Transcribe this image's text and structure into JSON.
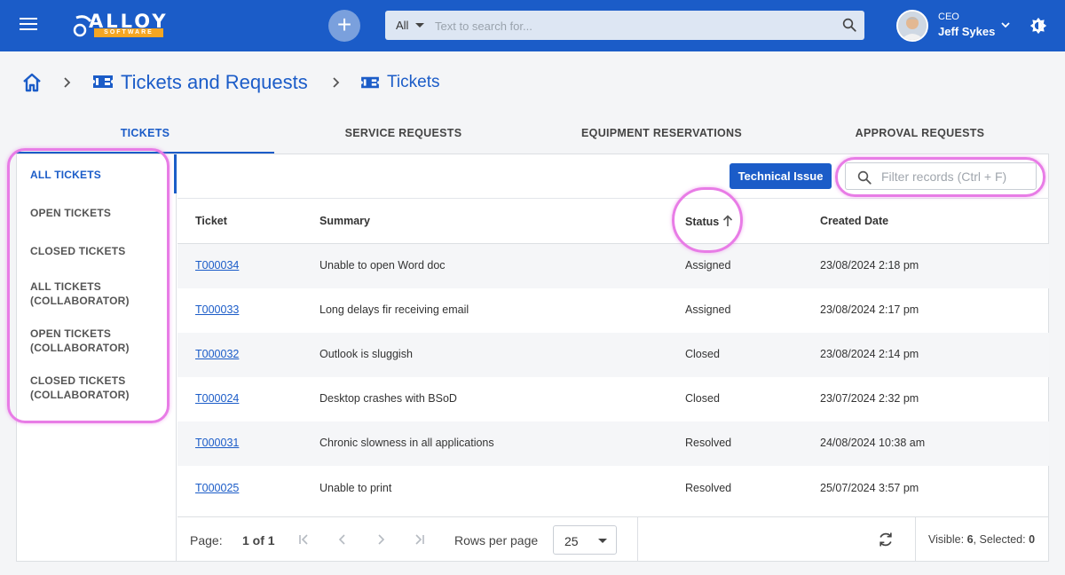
{
  "header": {
    "logo": {
      "word": "ALLOY",
      "sub": "SOFTWARE"
    },
    "add_button": "+",
    "search": {
      "scope": "All",
      "placeholder": "Text to search for..."
    },
    "user": {
      "role": "CEO",
      "name": "Jeff Sykes"
    }
  },
  "breadcrumb": {
    "section": "Tickets and Requests",
    "page": "Tickets"
  },
  "tabs": [
    {
      "label": "TICKETS",
      "active": true
    },
    {
      "label": "SERVICE REQUESTS",
      "active": false
    },
    {
      "label": "EQUIPMENT RESERVATIONS",
      "active": false
    },
    {
      "label": "APPROVAL REQUESTS",
      "active": false
    }
  ],
  "sidenav": {
    "items": [
      {
        "line1": "ALL TICKETS",
        "line2": ""
      },
      {
        "line1": "OPEN TICKETS",
        "line2": ""
      },
      {
        "line1": "CLOSED TICKETS",
        "line2": ""
      },
      {
        "line1": "ALL TICKETS",
        "line2": "(COLLABORATOR)"
      },
      {
        "line1": "OPEN TICKETS",
        "line2": "(COLLABORATOR)"
      },
      {
        "line1": "CLOSED TICKETS",
        "line2": "(COLLABORATOR)"
      }
    ]
  },
  "toolbar": {
    "tech_button": "Technical Issue",
    "filter_placeholder": "Filter records (Ctrl + F)"
  },
  "table": {
    "columns": [
      "Ticket",
      "Summary",
      "Status",
      "Created Date"
    ],
    "sort": {
      "column": "Status",
      "direction": "ascending"
    },
    "rows": [
      {
        "ticket": "T000034",
        "summary": "Unable to open Word doc",
        "status": "Assigned",
        "created": "23/08/2024 2:18 pm"
      },
      {
        "ticket": "T000033",
        "summary": "Long delays fir receiving email",
        "status": "Assigned",
        "created": "23/08/2024 2:17 pm"
      },
      {
        "ticket": "T000032",
        "summary": "Outlook is sluggish",
        "status": "Closed",
        "created": "23/08/2024 2:14 pm"
      },
      {
        "ticket": "T000024",
        "summary": "Desktop crashes with BSoD",
        "status": "Closed",
        "created": "23/07/2024 2:32 pm"
      },
      {
        "ticket": "T000031",
        "summary": "Chronic slowness in all applications",
        "status": "Resolved",
        "created": "24/08/2024 10:38 am"
      },
      {
        "ticket": "T000025",
        "summary": "Unable to print",
        "status": "Resolved",
        "created": "25/07/2024 3:57 pm"
      }
    ]
  },
  "footer": {
    "page_label": "Page:",
    "page_value": "1 of 1",
    "rows_per_page_label": "Rows per page",
    "rows_per_page": "25",
    "visible_label": "Visible:",
    "visible_count": "6",
    "selected_label": "Selected:",
    "selected_count": "0"
  },
  "colors": {
    "brand_blue": "#1b5cc8",
    "logo_orange": "#f5a623",
    "highlight": "#e87ce6"
  }
}
